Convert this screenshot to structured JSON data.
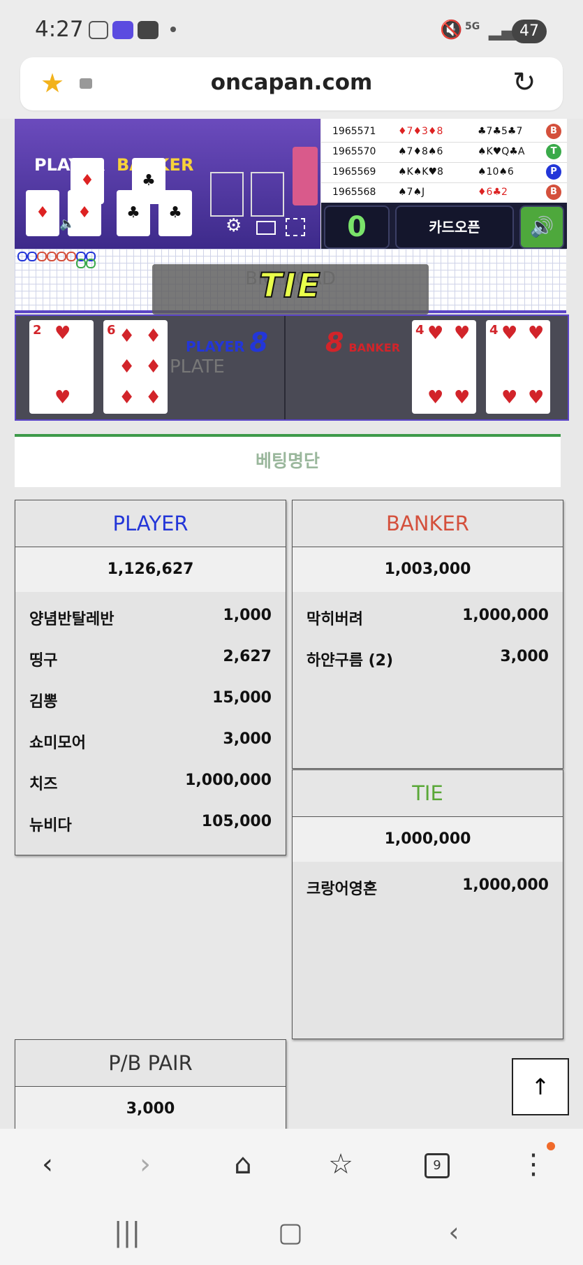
{
  "status_bar": {
    "time": "4:27",
    "battery": "47",
    "network": "5G"
  },
  "browser": {
    "url": "oncapan.com"
  },
  "video": {
    "player_label": "PLAYER",
    "banker_label": "BANKER"
  },
  "results": [
    {
      "id": "1965571",
      "player": "♦7♦3♦8",
      "banker": "♣7♣5♣7",
      "winner": "B"
    },
    {
      "id": "1965570",
      "player": "♠7♦8♠6",
      "banker": "♠K♥Q♣A",
      "winner": "T"
    },
    {
      "id": "1965569",
      "player": "♠K♠K♥8",
      "banker": "♠10♠6",
      "winner": "P"
    },
    {
      "id": "1965568",
      "player": "♠7♠J",
      "banker": "♦6♣2",
      "winner": "B"
    }
  ],
  "controls": {
    "counter": "0",
    "card_open": "카드오픈"
  },
  "road": {
    "bg_text": "BIG ROAD",
    "tie_text": "TIE"
  },
  "cards": {
    "player_label": "PLAYER",
    "player_score": "8",
    "banker_label": "BANKER",
    "banker_score": "8",
    "plate_text": "PLATE",
    "player_cards": [
      "2",
      "6"
    ],
    "banker_cards": [
      "4",
      "4"
    ]
  },
  "betting": {
    "title": "베팅명단",
    "player": {
      "title": "PLAYER",
      "total": "1,126,627",
      "rows": [
        {
          "name": "양념반탈레반",
          "amount": "1,000"
        },
        {
          "name": "띵구",
          "amount": "2,627"
        },
        {
          "name": "김뽕",
          "amount": "15,000"
        },
        {
          "name": "쇼미모어",
          "amount": "3,000"
        },
        {
          "name": "치즈",
          "amount": "1,000,000"
        },
        {
          "name": "뉴비다",
          "amount": "105,000"
        }
      ]
    },
    "banker": {
      "title": "BANKER",
      "total": "1,003,000",
      "rows": [
        {
          "name": "막히버려",
          "amount": "1,000,000"
        },
        {
          "name": "하얀구름 (2)",
          "amount": "3,000"
        }
      ]
    },
    "tie": {
      "title": "TIE",
      "total": "1,000,000",
      "rows": [
        {
          "name": "크랑어영혼",
          "amount": "1,000,000"
        }
      ]
    },
    "pair": {
      "title": "P/B PAIR",
      "total": "3,000"
    }
  },
  "toolbar": {
    "tabs_count": "9"
  },
  "colors": {
    "player": "#2336d8",
    "banker": "#d4503c",
    "tie": "#5aa838",
    "accent_green": "#3e9a4a"
  }
}
